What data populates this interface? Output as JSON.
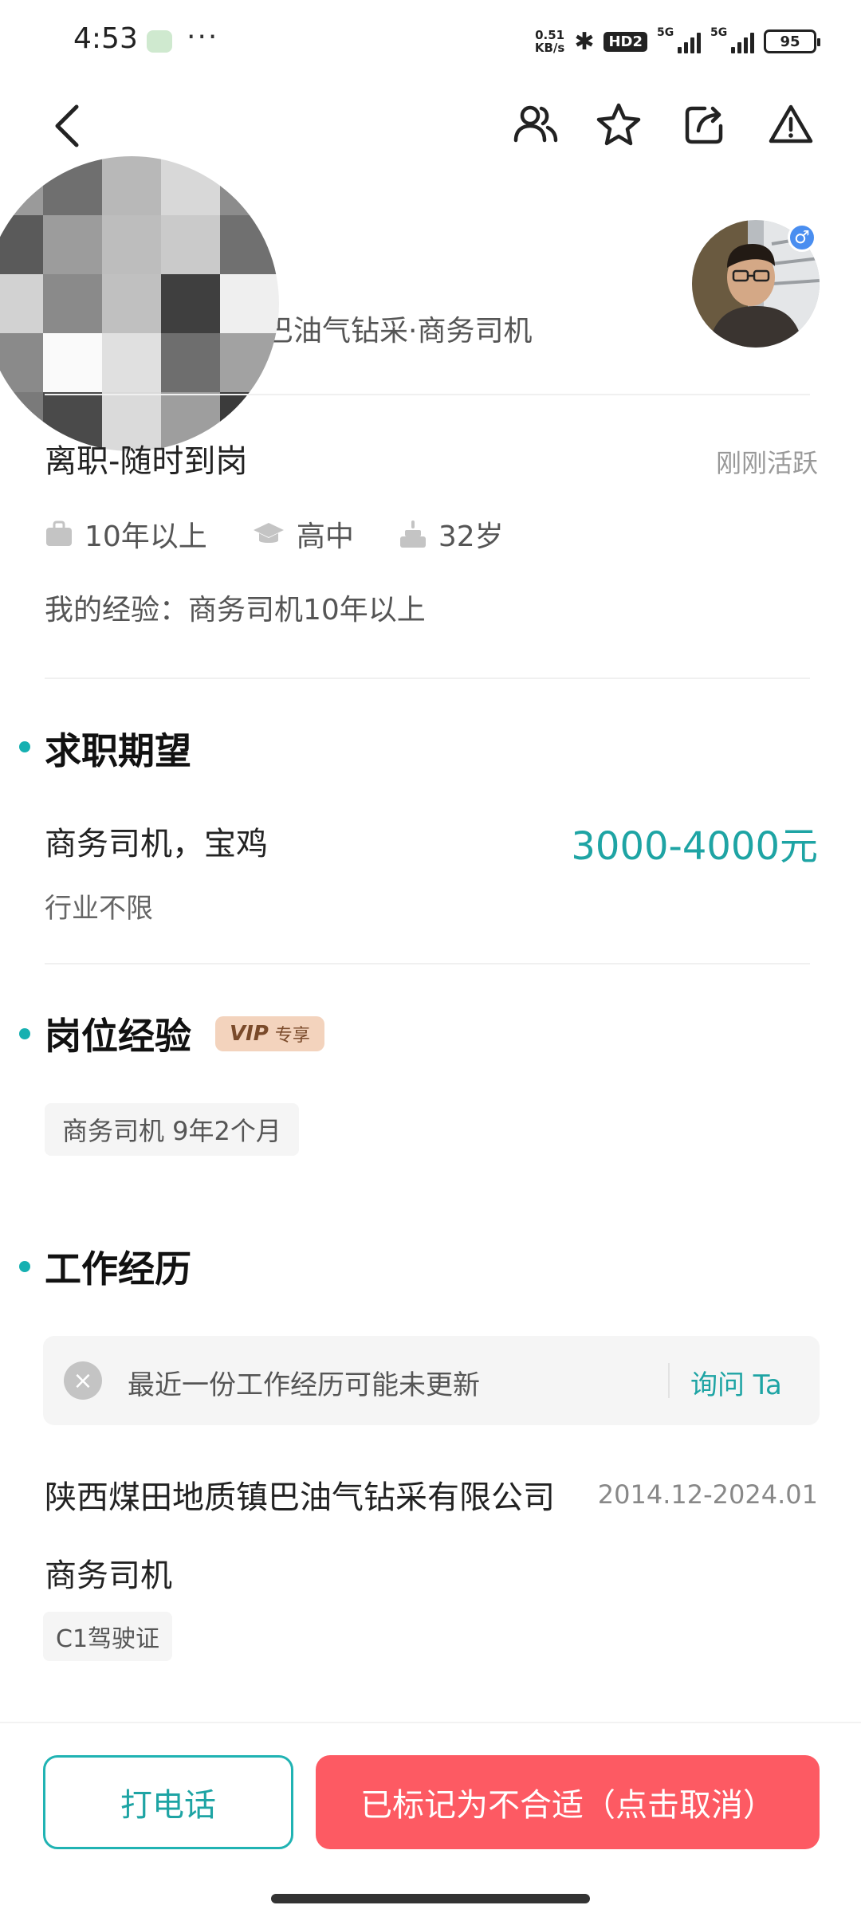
{
  "status_bar": {
    "time": "4:53",
    "dots": "···",
    "net_speed_value": "0.51",
    "net_speed_unit": "KB/s",
    "hd_label": "HD2",
    "network_1": "5G",
    "network_2": "5G",
    "battery": "95"
  },
  "nav": {
    "icons": [
      "back-icon",
      "people-icon",
      "star-icon",
      "share-icon",
      "warning-icon"
    ]
  },
  "profile": {
    "headline": "巴油气钻采·商务司机",
    "gender_symbol": "♂"
  },
  "status": {
    "availability": "离职-随时到岗",
    "activity": "刚刚活跃"
  },
  "meta": {
    "experience": "10年以上",
    "education": "高中",
    "age": "32岁"
  },
  "experience_summary": "我的经验：商务司机10年以上",
  "job_expectation": {
    "title": "求职期望",
    "job": "商务司机，宝鸡",
    "salary": "3000-4000元",
    "industry": "行业不限"
  },
  "position_experience": {
    "title": "岗位经验",
    "vip_label": "VIP",
    "vip_exclusive": "专享",
    "tag": "商务司机 9年2个月"
  },
  "work_history": {
    "title": "工作经历",
    "notice": "最近一份工作经历可能未更新",
    "notice_action": "询问 Ta",
    "company": "陕西煤田地质镇巴油气钻采有限公司",
    "period": "2014.12-2024.01",
    "position": "商务司机",
    "license": "C1驾驶证"
  },
  "actions": {
    "call": "打电话",
    "marked": "已标记为不合适（点击取消）"
  },
  "colors": {
    "accent": "#1ea4a4",
    "danger": "#fd5a63",
    "vip_bg": "#f3d3bd"
  }
}
